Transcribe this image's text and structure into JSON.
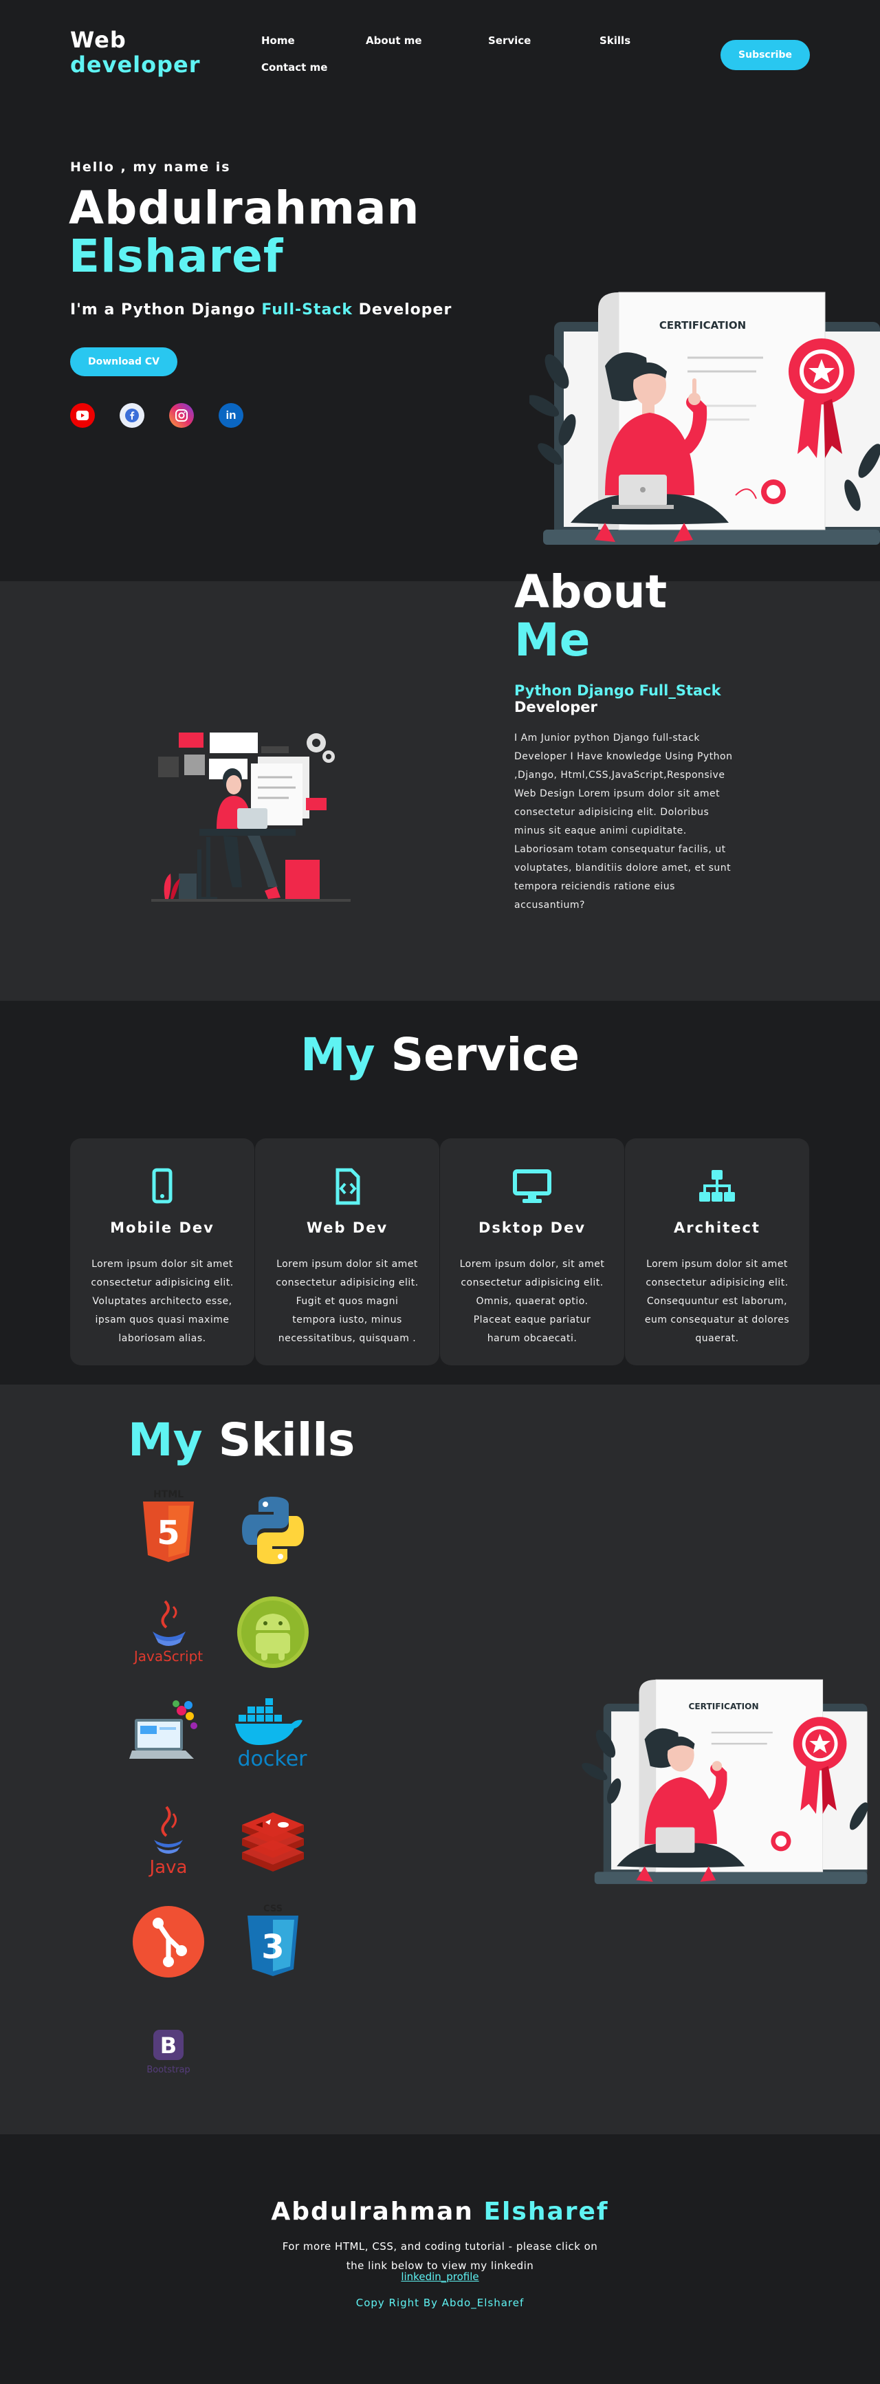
{
  "header": {
    "logo_line1": "Web",
    "logo_line2": "developer",
    "nav": [
      "Home",
      "About me",
      "Service",
      "Skills",
      "Contact me"
    ],
    "subscribe_label": "Subscribe"
  },
  "hero": {
    "greeting": "Hello , my name is",
    "first_name": "Abdulrahman",
    "last_name": "Elsharef",
    "role_prefix": "I'm a Python Django ",
    "role_highlight": "Full-Stack",
    "role_suffix": " Developer",
    "download_label": "Download CV",
    "social_icons": [
      "youtube-icon",
      "facebook-icon",
      "instagram-icon",
      "linkedin-icon"
    ],
    "illustration_text": "CERTIFICATION"
  },
  "about": {
    "title_line1": "About",
    "title_line2": "Me",
    "subtitle_highlight": "Python Django Full_Stack",
    "subtitle_rest": "Developer",
    "text": "I Am Junior python Django full-stack Developer I Have knowledge Using Python ,Django, Html,CSS,JavaScript,Responsive Web Design Lorem ipsum dolor sit amet consectetur adipisicing elit. Doloribus minus sit eaque animi cupiditate. Laboriosam totam consequatur facilis, ut voluptates, blanditiis dolore amet, et sunt tempora reiciendis ratione eius accusantium?"
  },
  "service": {
    "title_highlight": "My",
    "title_rest": "Service",
    "cards": [
      {
        "icon": "mobile-icon",
        "title": "Mobile Dev",
        "text": "Lorem ipsum dolor sit amet consectetur adipisicing elit. Voluptates architecto esse, ipsam quos quasi maxime laboriosam alias."
      },
      {
        "icon": "code-file-icon",
        "title": "Web Dev",
        "text": "Lorem ipsum dolor sit amet consectetur adipisicing elit. Fugit et quos magni tempora iusto, minus necessitatibus, quisquam ."
      },
      {
        "icon": "desktop-icon",
        "title": "Dsktop Dev",
        "text": "Lorem ipsum dolor, sit amet consectetur adipisicing elit. Omnis, quaerat optio. Placeat eaque pariatur harum obcaecati."
      },
      {
        "icon": "sitemap-icon",
        "title": "Architect",
        "text": "Lorem ipsum dolor sit amet consectetur adipisicing elit. Consequuntur est laborum, eum consequatur at dolores quaerat."
      }
    ]
  },
  "skills": {
    "title_highlight": "My",
    "title_rest": "Skills",
    "logos": [
      "html5-logo",
      "python-logo",
      "javascript-logo",
      "android-logo",
      "web-design-logo",
      "docker-logo",
      "java-logo",
      "redis-logo",
      "git-logo",
      "css3-logo",
      "bootstrap-logo"
    ],
    "logo_text": {
      "html": "HTML",
      "javascript": "JavaScript",
      "docker": "docker",
      "java": "Java",
      "css": "CSS",
      "bootstrap": "Bootstrap"
    },
    "illustration_text": "CERTIFICATION"
  },
  "footer": {
    "name_first": "Abdulrahman",
    "name_last": "Elsharef",
    "text": "For more HTML, CSS, and coding tutorial - please click on the link below to view my linkedin",
    "link": "linkedin_profile",
    "copyright": "Copy Right By Abdo_Elsharef"
  },
  "colors": {
    "accent": "#5ff3f3",
    "button": "#29c7f0",
    "dark": "#1c1d1f",
    "panel": "#2a2b2d",
    "illustration_red": "#f0284a"
  }
}
